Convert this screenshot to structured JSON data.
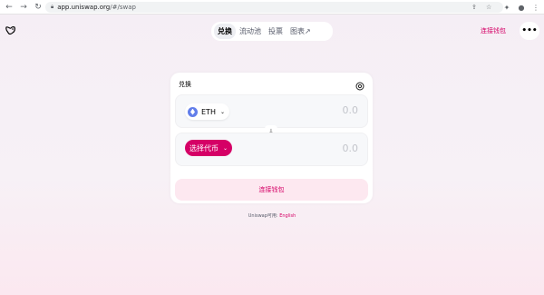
{
  "browser": {
    "url_host": "app.uniswap.org",
    "url_path": "/#/swap"
  },
  "header": {
    "tabs": [
      {
        "label": "兑换",
        "active": true
      },
      {
        "label": "流动池",
        "active": false
      },
      {
        "label": "投票",
        "active": false
      },
      {
        "label": "图表↗",
        "active": false
      }
    ],
    "connect_label": "连接钱包",
    "more_label": "•••"
  },
  "swap": {
    "title": "兑换",
    "from_token": "ETH",
    "from_amount": "0.0",
    "to_token_label": "选择代币",
    "to_amount": "0.0",
    "connect_button": "连接钱包"
  },
  "footer": {
    "prefix": "Uniswap可用: ",
    "language": "English"
  },
  "colors": {
    "accent": "#d50066",
    "eth": "#627eea"
  }
}
